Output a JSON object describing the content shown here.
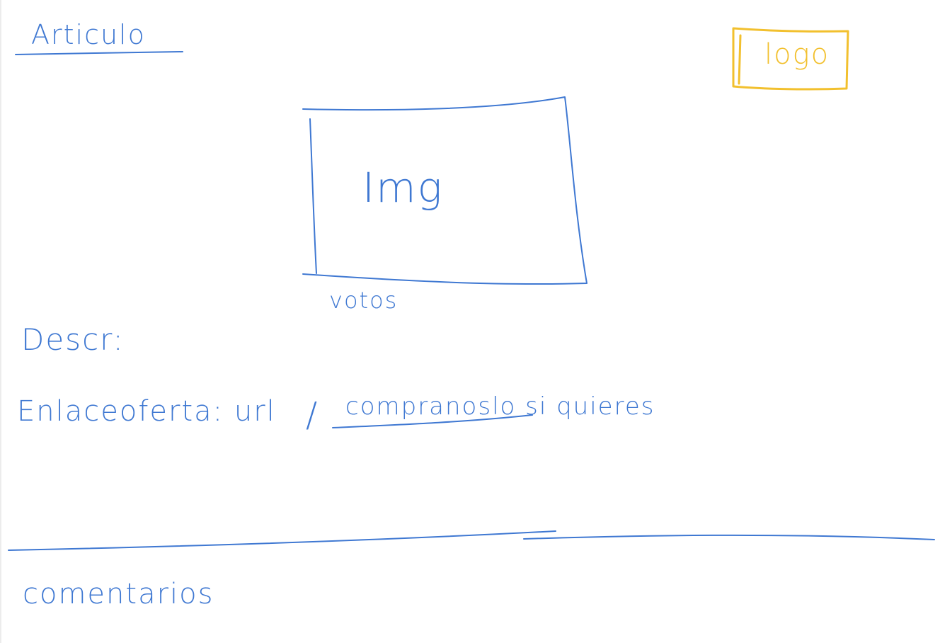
{
  "colors": {
    "ink_blue": "#3f78d2",
    "ink_yellow": "#f2c02e"
  },
  "header": {
    "title": "Articulo",
    "logo": "logo"
  },
  "media": {
    "image_label": "Img",
    "votes_label": "votos"
  },
  "details": {
    "description": "Descr:",
    "link_label": "Enlaceoferta: url",
    "separator": "/",
    "buy_link": "compranoslo si quieres"
  },
  "comments": {
    "label": "comentarios"
  }
}
